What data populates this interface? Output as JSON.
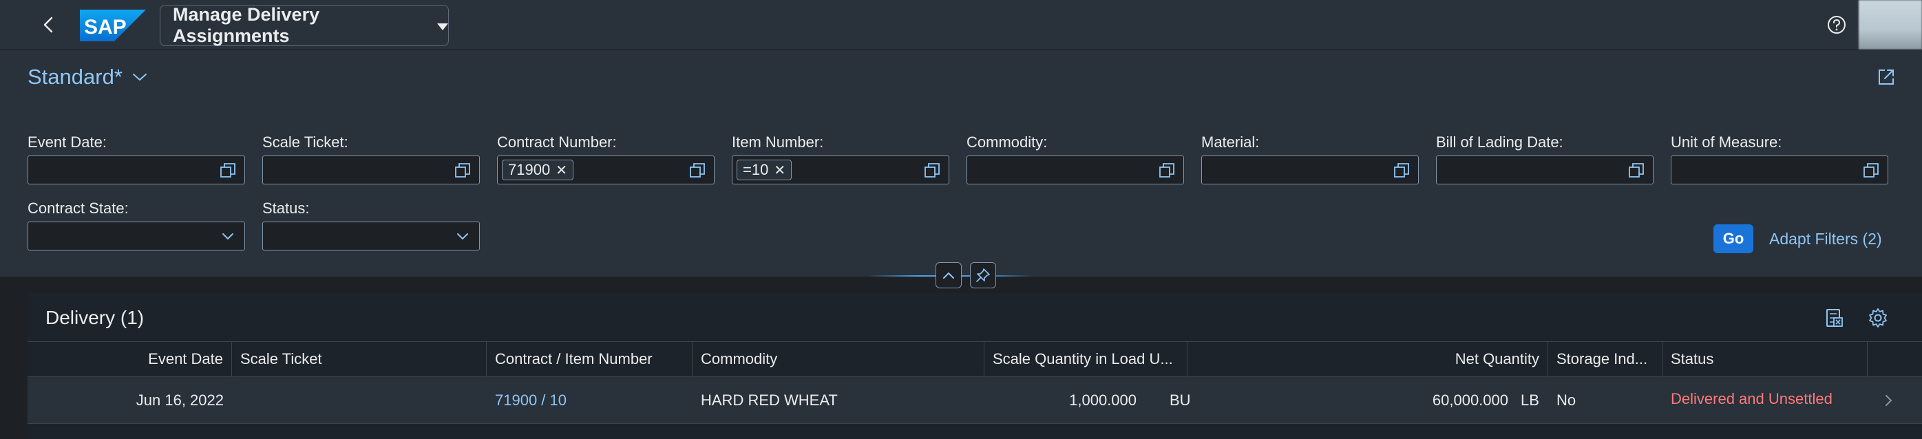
{
  "shell": {
    "logo_text": "SAP",
    "app_title": "Manage Delivery Assignments"
  },
  "filterbar": {
    "variant_name": "Standard*",
    "fields": [
      {
        "label": "Event Date:",
        "tokens": []
      },
      {
        "label": "Scale Ticket:",
        "tokens": []
      },
      {
        "label": "Contract Number:",
        "tokens": [
          "71900"
        ]
      },
      {
        "label": "Item Number:",
        "tokens": [
          "=10"
        ]
      },
      {
        "label": "Commodity:",
        "tokens": []
      },
      {
        "label": "Material:",
        "tokens": []
      },
      {
        "label": "Bill of Lading Date:",
        "tokens": []
      },
      {
        "label": "Unit of Measure:",
        "tokens": []
      },
      {
        "label": "Contract State:",
        "tokens": []
      },
      {
        "label": "Status:",
        "tokens": []
      }
    ],
    "go_label": "Go",
    "adapt_filters_label": "Adapt Filters (2)"
  },
  "table": {
    "title": "Delivery (1)",
    "columns": [
      "Event Date",
      "Scale Ticket",
      "Contract / Item Number",
      "Commodity",
      "Scale Quantity in Load U...",
      "Net Quantity",
      "Storage Ind...",
      "Status"
    ],
    "rows": [
      {
        "event_date": "Jun 16, 2022",
        "scale_ticket": "",
        "contract_item": "71900 / 10",
        "commodity": "HARD RED WHEAT",
        "scale_quantity": "1,000.000",
        "scale_unit": "BU",
        "net_quantity": "60,000.000",
        "net_unit": "LB",
        "storage_ind": "No",
        "status": "Delivered and Unsettled"
      }
    ]
  },
  "colors": {
    "shell_bg": "#29313a",
    "page_bg": "#1d2126",
    "link": "#8fc6f5",
    "emphasized_button": "#1a73d9",
    "negative_status": "#ff7a7a"
  },
  "icons": {
    "back": "back-icon",
    "help": "help-icon",
    "share": "share-icon",
    "value_help": "value-help-icon",
    "dropdown": "chevron-down-icon",
    "collapse": "chevron-up-icon",
    "pin": "pin-icon",
    "export": "export-to-excel-icon",
    "settings": "gear-icon",
    "row_navigation": "chevron-right-icon"
  }
}
